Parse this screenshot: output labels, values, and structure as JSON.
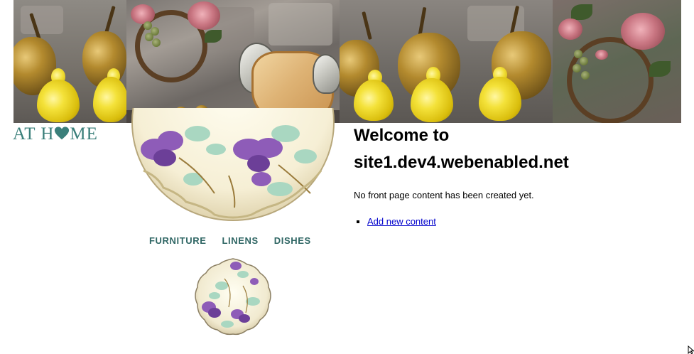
{
  "site": {
    "logo_text_left": "AT H",
    "logo_text_right": "ME",
    "logo_color": "#3a7f7a"
  },
  "nav": {
    "items": [
      {
        "label": "FURNITURE"
      },
      {
        "label": "LINENS"
      },
      {
        "label": "DISHES"
      }
    ],
    "color": "#2f6664"
  },
  "main": {
    "title_line1": "Welcome to",
    "title_line2": "site1.dev4.webenabled.net",
    "message": "No front page content has been created yet.",
    "links": [
      {
        "label": "Add new content"
      }
    ],
    "link_color": "#0000cc"
  },
  "icons": {
    "logo_heart": "heart-icon",
    "cursor": "mouse-cursor-icon"
  }
}
